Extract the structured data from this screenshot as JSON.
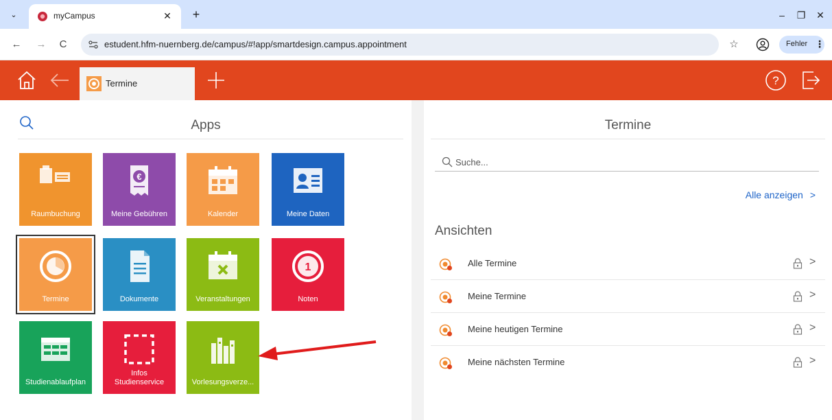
{
  "browser": {
    "tab_title": "myCampus",
    "url": "estudent.hfm-nuernberg.de/campus/#!app/smartdesign.campus.appointment",
    "tab_list_glyph": "⌄",
    "close_glyph": "✕",
    "new_tab_glyph": "+",
    "back_glyph": "←",
    "forward_glyph": "→",
    "reload_glyph": "C",
    "star_glyph": "☆",
    "minimize_glyph": "–",
    "restore_glyph": "❐",
    "window_close_glyph": "✕",
    "error_chip_label": "Fehler",
    "menu_glyph": "⋮"
  },
  "header": {
    "active_tab_label": "Termine",
    "accent_color": "#e1461e"
  },
  "apps_panel": {
    "title": "Apps",
    "tiles": [
      {
        "label": "Raumbuchung",
        "color": "#f0942e",
        "icon": "room-booking-icon"
      },
      {
        "label": "Meine Gebühren",
        "color": "#8e4baa",
        "icon": "fees-icon"
      },
      {
        "label": "Kalender",
        "color": "#f59b48",
        "icon": "calendar-icon"
      },
      {
        "label": "Meine Daten",
        "color": "#1e64c0",
        "icon": "id-card-icon"
      },
      {
        "label": "Termine",
        "color": "#f59b48",
        "icon": "appointments-icon"
      },
      {
        "label": "Dokumente",
        "color": "#2a8fc4",
        "icon": "document-icon"
      },
      {
        "label": "Veranstaltungen",
        "color": "#8cbb14",
        "icon": "events-icon"
      },
      {
        "label": "Noten",
        "color": "#e61e3c",
        "icon": "grades-icon"
      },
      {
        "label": "Studienablaufplan",
        "color": "#18a35a",
        "icon": "study-plan-icon"
      },
      {
        "label": "Infos\nStudienservice",
        "color": "#e61e3c",
        "icon": "info-service-icon"
      },
      {
        "label": "Vorlesungsverze...",
        "color": "#8cbb14",
        "icon": "course-catalog-icon"
      }
    ]
  },
  "termine_panel": {
    "title": "Termine",
    "search_placeholder": "Suche...",
    "show_all_label": "Alle anzeigen",
    "chevron_glyph": ">",
    "views_heading": "Ansichten",
    "views": [
      {
        "label": "Alle Termine"
      },
      {
        "label": "Meine Termine"
      },
      {
        "label": "Meine heutigen Termine"
      },
      {
        "label": "Meine nächsten Termine"
      }
    ]
  },
  "colors": {
    "link": "#1e64c8",
    "annotation_arrow": "#e01b1b"
  }
}
